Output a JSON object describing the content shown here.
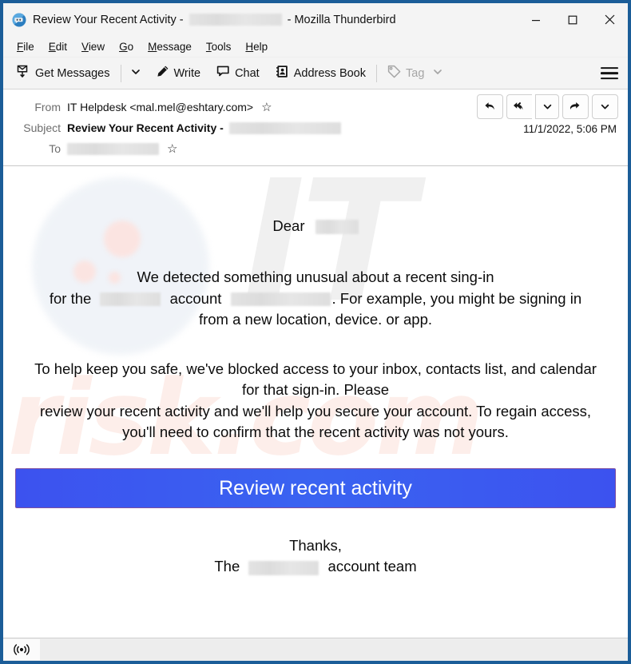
{
  "window": {
    "title_prefix": "Review Your Recent Activity -",
    "title_suffix": "- Mozilla Thunderbird",
    "app_name": "Mozilla Thunderbird",
    "border_color": "#1b5d98",
    "controls": {
      "minimize": "minimize",
      "maximize": "maximize",
      "close": "close"
    }
  },
  "menubar": {
    "items": [
      {
        "accel": "F",
        "rest": "ile"
      },
      {
        "accel": "E",
        "rest": "dit"
      },
      {
        "accel": "V",
        "rest": "iew"
      },
      {
        "accel": "G",
        "rest": "o"
      },
      {
        "accel": "M",
        "rest": "essage"
      },
      {
        "accel": "T",
        "rest": "ools"
      },
      {
        "accel": "H",
        "rest": "elp"
      }
    ]
  },
  "toolbar": {
    "get_messages": "Get Messages",
    "write": "Write",
    "chat": "Chat",
    "address_book": "Address Book",
    "tag": "Tag",
    "app_menu": "app-menu"
  },
  "message_header": {
    "from_label": "From",
    "from_value": "IT Helpdesk <mal.mel@eshtary.com>",
    "subject_label": "Subject",
    "subject_value": "Review Your Recent Activity -",
    "to_label": "To",
    "to_value": "",
    "date": "11/1/2022, 5:06 PM",
    "actions": [
      "reply",
      "reply-all",
      "reply-all-dropdown",
      "forward",
      "more-dropdown"
    ]
  },
  "email": {
    "greeting": "Dear",
    "paragraph1": [
      "We detected something unusual about a recent sing-in",
      "for the \u0000 account \u0000. For example, you might be signing in",
      "from a new location, device. or app."
    ],
    "p1_l2_pre": "for the",
    "p1_l2_mid": "account",
    "p1_l2_post": ". For example, you might be signing in",
    "paragraph2": [
      "To help keep you safe, we've blocked access to your inbox, contacts list, and calendar",
      "for that sign-in. Please",
      "review your recent activity and we'll help you secure your account. To regain access,",
      "you'll need to confirm that the recent activity was not yours."
    ],
    "cta_label": "Review recent activity",
    "cta_color": "#3a5bf0",
    "cta_border_color": "#7c4fa2",
    "closing_thanks": "Thanks,",
    "closing_pre": "The",
    "closing_post": "account team",
    "watermark_it": "IT",
    "watermark_risk": "risk.com"
  },
  "statusbar": {
    "icon": "broadcast-icon",
    "text": ""
  }
}
